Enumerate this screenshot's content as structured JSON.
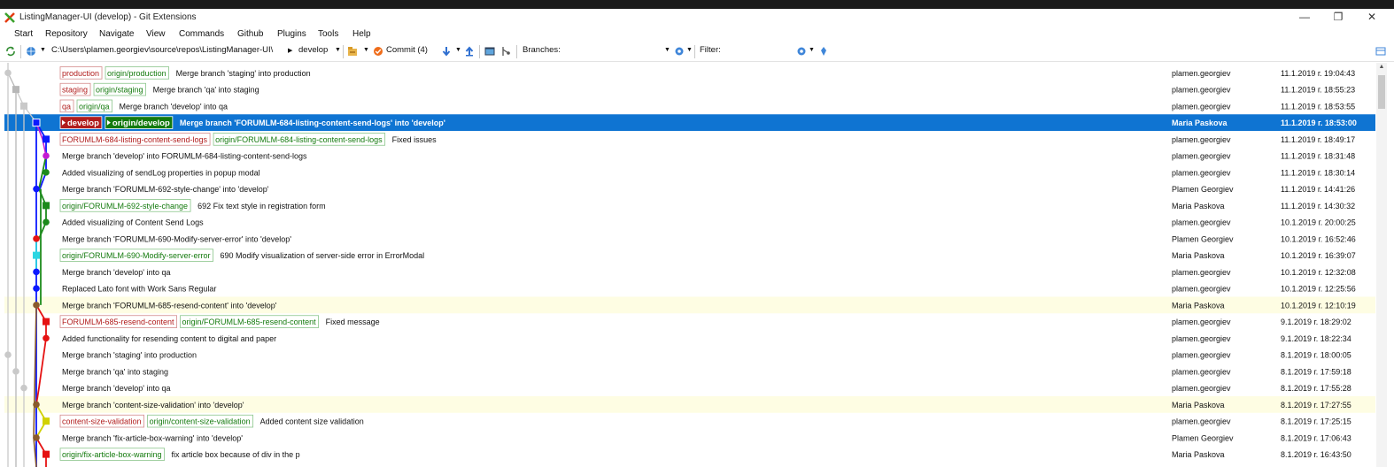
{
  "window": {
    "title": "ListingManager-UI (develop) - Git Extensions",
    "controls": {
      "minimize": "—",
      "restore": "❐",
      "close": "✕"
    }
  },
  "menu": [
    "Start",
    "Repository",
    "Navigate",
    "View",
    "Commands",
    "Github",
    "Plugins",
    "Tools",
    "Help"
  ],
  "toolbar": {
    "path": "C:\\Users\\plamen.georgiev\\source\\repos\\ListingManager-UI\\",
    "branch": "develop",
    "commit_label": "Commit (4)",
    "branches_label": "Branches:",
    "filter_label": "Filter:"
  },
  "colors": {
    "selection": "#0f74d2",
    "highlight_row": "#fefde3",
    "local_branch": "#b11c1c",
    "remote_branch": "#137a0d"
  },
  "lane_colors": [
    "#c9c9c9",
    "#b7b7b7",
    "#c9c9c9",
    "#0b18ff",
    "#1c8a1c",
    "#c41ad2",
    "#2bd6e2",
    "#e51212",
    "#d1d104",
    "#8a5b2c"
  ],
  "commits": [
    {
      "refs": [
        {
          "name": "production",
          "type": "local"
        },
        {
          "name": "origin/production",
          "type": "remote"
        }
      ],
      "message": "Merge branch 'staging' into production",
      "author": "plamen.georgiev",
      "date": "11.1.2019 г. 19:04:43",
      "highlight": false,
      "lane": 0,
      "color": "#c9c9c9",
      "dot": "circle"
    },
    {
      "refs": [
        {
          "name": "staging",
          "type": "local"
        },
        {
          "name": "origin/staging",
          "type": "remote"
        }
      ],
      "message": "Merge branch 'qa' into staging",
      "author": "plamen.georgiev",
      "date": "11.1.2019 г. 18:55:23",
      "highlight": false,
      "lane": 1,
      "color": "#b7b7b7",
      "dot": "square"
    },
    {
      "refs": [
        {
          "name": "qa",
          "type": "local"
        },
        {
          "name": "origin/qa",
          "type": "remote"
        }
      ],
      "message": "Merge branch 'develop' into qa",
      "author": "plamen.georgiev",
      "date": "11.1.2019 г. 18:53:55",
      "highlight": false,
      "lane": 2,
      "color": "#c9c9c9",
      "dot": "square"
    },
    {
      "refs": [
        {
          "name": "develop",
          "type": "local"
        },
        {
          "name": "origin/develop",
          "type": "remote"
        }
      ],
      "message": "Merge branch 'FORUMLM-684-listing-content-send-logs' into 'develop'",
      "author": "Maria Paskova",
      "date": "11.1.2019 г. 18:53:00",
      "highlight": false,
      "selected": true,
      "lane": 3,
      "color": "#0b18ff",
      "dot": "square"
    },
    {
      "refs": [
        {
          "name": "FORUMLM-684-listing-content-send-logs",
          "type": "local"
        },
        {
          "name": "origin/FORUMLM-684-listing-content-send-logs",
          "type": "remote"
        }
      ],
      "message": "Fixed issues",
      "author": "plamen.georgiev",
      "date": "11.1.2019 г. 18:49:17",
      "highlight": false,
      "lane": 5,
      "color": "#0b18ff",
      "dot": "square"
    },
    {
      "refs": [],
      "message": "Merge branch 'develop' into FORUMLM-684-listing-content-send-logs",
      "author": "plamen.georgiev",
      "date": "11.1.2019 г. 18:31:48",
      "highlight": false,
      "lane": 5,
      "color": "#c41ad2",
      "dot": "circle"
    },
    {
      "refs": [],
      "message": "Added visualizing of sendLog properties in popup modal",
      "author": "plamen.georgiev",
      "date": "11.1.2019 г. 18:30:14",
      "highlight": false,
      "lane": 5,
      "color": "#1c8a1c",
      "dot": "circle"
    },
    {
      "refs": [],
      "message": "Merge branch 'FORUMLM-692-style-change' into 'develop'",
      "author": "Plamen Georgiev",
      "date": "11.1.2019 г. 14:41:26",
      "highlight": false,
      "lane": 4,
      "color": "#0b18ff",
      "dot": "circle"
    },
    {
      "refs": [
        {
          "name": "origin/FORUMLM-692-style-change",
          "type": "remote"
        }
      ],
      "message": "692 Fix text style in registration form",
      "author": "Maria Paskova",
      "date": "11.1.2019 г. 14:30:32",
      "highlight": false,
      "lane": 5,
      "color": "#1c8a1c",
      "dot": "square"
    },
    {
      "refs": [],
      "message": "Added visualizing of Content Send Logs",
      "author": "plamen.georgiev",
      "date": "10.1.2019 г. 20:00:25",
      "highlight": false,
      "lane": 5,
      "color": "#1c8a1c",
      "dot": "circle"
    },
    {
      "refs": [],
      "message": "Merge branch 'FORUMLM-690-Modify-server-error' into 'develop'",
      "author": "Plamen Georgiev",
      "date": "10.1.2019 г. 16:52:46",
      "highlight": false,
      "lane": 4,
      "color": "#e51212",
      "dot": "circle"
    },
    {
      "refs": [
        {
          "name": "origin/FORUMLM-690-Modify-server-error",
          "type": "remote"
        }
      ],
      "message": "690 Modify visualization of server-side error in ErrorModal",
      "author": "Maria Paskova",
      "date": "10.1.2019 г. 16:39:07",
      "highlight": false,
      "lane": 4,
      "color": "#2bd6e2",
      "dot": "square"
    },
    {
      "refs": [],
      "message": "Merge branch 'develop' into qa",
      "author": "plamen.georgiev",
      "date": "10.1.2019 г. 12:32:08",
      "highlight": false,
      "lane": 4,
      "color": "#0b18ff",
      "dot": "circle"
    },
    {
      "refs": [],
      "message": "Replaced Lato font with Work Sans Regular",
      "author": "plamen.georgiev",
      "date": "10.1.2019 г. 12:25:56",
      "highlight": false,
      "lane": 4,
      "color": "#0b18ff",
      "dot": "circle"
    },
    {
      "refs": [],
      "message": "Merge branch 'FORUMLM-685-resend-content' into 'develop'",
      "author": "Maria Paskova",
      "date": "10.1.2019 г. 12:10:19",
      "highlight": true,
      "lane": 4,
      "color": "#8a5b2c",
      "dot": "circle"
    },
    {
      "refs": [
        {
          "name": "FORUMLM-685-resend-content",
          "type": "local"
        },
        {
          "name": "origin/FORUMLM-685-resend-content",
          "type": "remote"
        }
      ],
      "message": "Fixed message",
      "author": "plamen.georgiev",
      "date": "9.1.2019 г. 18:29:02",
      "highlight": false,
      "lane": 5,
      "color": "#e51212",
      "dot": "square"
    },
    {
      "refs": [],
      "message": "Added functionality for resending content to digital and paper",
      "author": "plamen.georgiev",
      "date": "9.1.2019 г. 18:22:34",
      "highlight": false,
      "lane": 5,
      "color": "#e51212",
      "dot": "circle"
    },
    {
      "refs": [],
      "message": "Merge branch 'staging' into production",
      "author": "plamen.georgiev",
      "date": "8.1.2019 г. 18:00:05",
      "highlight": false,
      "lane": 0,
      "color": "#c9c9c9",
      "dot": "circle"
    },
    {
      "refs": [],
      "message": "Merge branch 'qa' into staging",
      "author": "plamen.georgiev",
      "date": "8.1.2019 г. 17:59:18",
      "highlight": false,
      "lane": 1,
      "color": "#c9c9c9",
      "dot": "circle"
    },
    {
      "refs": [],
      "message": "Merge branch 'develop' into qa",
      "author": "plamen.georgiev",
      "date": "8.1.2019 г. 17:55:28",
      "highlight": false,
      "lane": 2,
      "color": "#c9c9c9",
      "dot": "circle"
    },
    {
      "refs": [],
      "message": "Merge branch 'content-size-validation' into 'develop'",
      "author": "Maria Paskova",
      "date": "8.1.2019 г. 17:27:55",
      "highlight": true,
      "lane": 4,
      "color": "#8a5b2c",
      "dot": "circle"
    },
    {
      "refs": [
        {
          "name": "content-size-validation",
          "type": "local"
        },
        {
          "name": "origin/content-size-validation",
          "type": "remote"
        }
      ],
      "message": "Added content size validation",
      "author": "plamen.georgiev",
      "date": "8.1.2019 г. 17:25:15",
      "highlight": false,
      "lane": 5,
      "color": "#d1d104",
      "dot": "square"
    },
    {
      "refs": [],
      "message": "Merge branch 'fix-article-box-warning' into 'develop'",
      "author": "Plamen Georgiev",
      "date": "8.1.2019 г. 17:06:43",
      "highlight": false,
      "lane": 4,
      "color": "#8a5b2c",
      "dot": "circle"
    },
    {
      "refs": [
        {
          "name": "origin/fix-article-box-warning",
          "type": "remote"
        }
      ],
      "message": "fix article box because of div in the p",
      "author": "Maria Paskova",
      "date": "8.1.2019 г. 16:43:50",
      "highlight": false,
      "lane": 5,
      "color": "#e51212",
      "dot": "square"
    }
  ]
}
